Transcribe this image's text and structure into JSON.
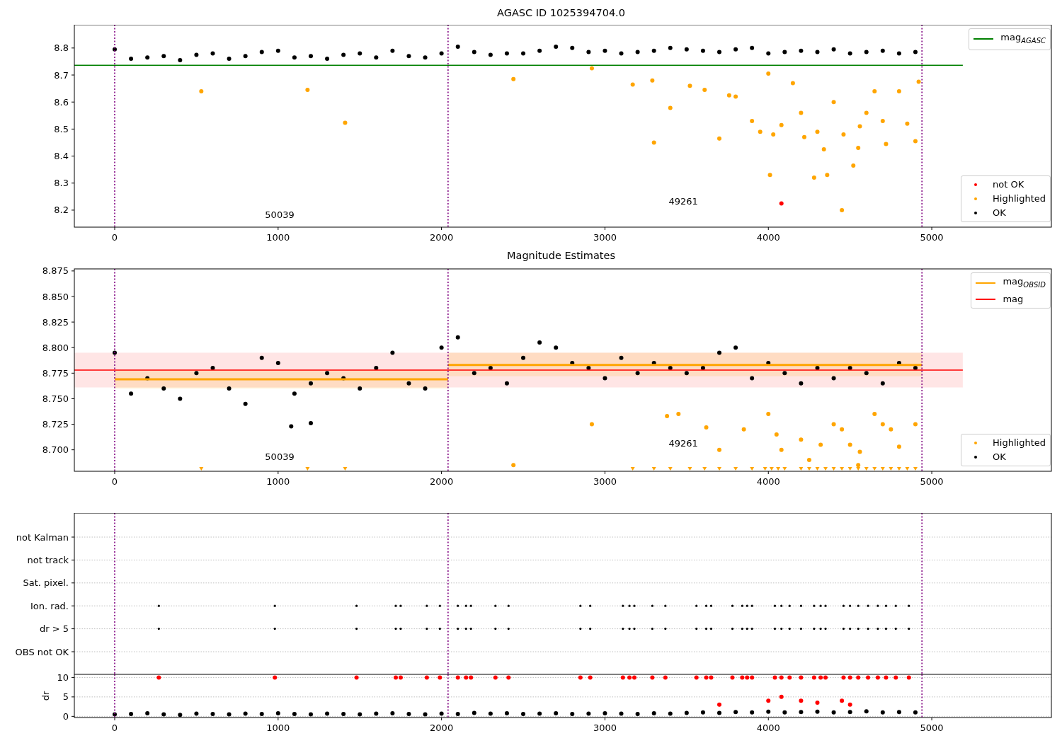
{
  "figure": {
    "axes": [
      {
        "title": "AGASC ID 1025394704.0",
        "chart_data": {
          "type": "scatter",
          "legend": "right",
          "xlim": [
            -247,
            5732
          ],
          "ylim": [
            8.137,
            8.886
          ],
          "xticks": [
            0,
            1000,
            2000,
            3000,
            4000,
            5000
          ],
          "yticks": [
            {
              "value": 8.2,
              "label": "8.2"
            },
            {
              "value": 8.3,
              "label": "8.3"
            },
            {
              "value": 8.4,
              "label": "8.4"
            },
            {
              "value": 8.5,
              "label": "8.5"
            },
            {
              "value": 8.6,
              "label": "8.6"
            },
            {
              "value": 8.7,
              "label": "8.7"
            },
            {
              "value": 8.8,
              "label": "8.8"
            }
          ],
          "series": [
            {
              "name": "mag$_{AGASC}$",
              "type": "line",
              "color": "#008000",
              "x": [
                -247,
                5190
              ],
              "values": [
                8.736,
                8.736
              ]
            },
            {
              "name": "OK",
              "color": "#000000",
              "marker": "circle",
              "x": [
                0,
                100,
                200,
                300,
                400,
                500,
                600,
                700,
                800,
                900,
                1000,
                1100,
                1200,
                1300,
                1400,
                1500,
                1600,
                1700,
                1800,
                1900,
                2000,
                2100,
                2200,
                2300,
                2400,
                2500,
                2600,
                2700,
                2800,
                2900,
                3000,
                3100,
                3200,
                3300,
                3400,
                3500,
                3600,
                3700,
                3800,
                3900,
                4000,
                4100,
                4200,
                4300,
                4400,
                4500,
                4600,
                4700,
                4800,
                4900
              ],
              "values": [
                8.795,
                8.76,
                8.765,
                8.77,
                8.755,
                8.775,
                8.78,
                8.76,
                8.77,
                8.785,
                8.79,
                8.765,
                8.77,
                8.76,
                8.775,
                8.78,
                8.765,
                8.79,
                8.77,
                8.765,
                8.78,
                8.805,
                8.785,
                8.775,
                8.78,
                8.78,
                8.79,
                8.805,
                8.8,
                8.785,
                8.79,
                8.78,
                8.785,
                8.79,
                8.8,
                8.795,
                8.79,
                8.785,
                8.795,
                8.8,
                8.78,
                8.785,
                8.79,
                8.785,
                8.795,
                8.78,
                8.785,
                8.79,
                8.78,
                8.785
              ]
            },
            {
              "name": "Highlighted",
              "color": "#ffa500",
              "marker": "circle",
              "x": [
                530,
                1180,
                1410,
                2440,
                2920,
                3170,
                3290,
                3300,
                3400,
                3520,
                3610,
                3700,
                3760,
                3800,
                3900,
                3950,
                4000,
                4010,
                4030,
                4080,
                4150,
                4200,
                4220,
                4280,
                4300,
                4340,
                4360,
                4400,
                4450,
                4460,
                4520,
                4550,
                4560,
                4600,
                4650,
                4700,
                4720,
                4800,
                4850,
                4900,
                4920
              ],
              "values": [
                8.64,
                8.645,
                8.523,
                8.685,
                8.725,
                8.665,
                8.68,
                8.45,
                8.578,
                8.66,
                8.645,
                8.465,
                8.625,
                8.62,
                8.53,
                8.49,
                8.705,
                8.33,
                8.48,
                8.515,
                8.67,
                8.56,
                8.47,
                8.32,
                8.49,
                8.425,
                8.33,
                8.6,
                8.2,
                8.48,
                8.365,
                8.43,
                8.51,
                8.56,
                8.64,
                8.53,
                8.445,
                8.64,
                8.52,
                8.455,
                8.675
              ]
            },
            {
              "name": "not OK",
              "color": "#ff0000",
              "marker": "circle",
              "x": [
                4080
              ],
              "values": [
                8.225
              ]
            }
          ],
          "ref_lines": [
            {
              "axis": "x",
              "value": 0,
              "color": "#800080"
            },
            {
              "axis": "x",
              "value": 2040,
              "color": "#800080"
            },
            {
              "axis": "x",
              "value": 4940,
              "color": "#800080"
            }
          ],
          "annotations": [
            "50039",
            "49261"
          ]
        }
      },
      {
        "title": "Magnitude Estimates",
        "chart_data": {
          "type": "scatter",
          "legend": "right",
          "xlim": [
            -247,
            5732
          ],
          "ylim": [
            8.679,
            8.877
          ],
          "xticks": [
            0,
            1000,
            2000,
            3000,
            4000,
            5000
          ],
          "yticks": [
            {
              "value": 8.7,
              "label": "8.700"
            },
            {
              "value": 8.725,
              "label": "8.725"
            },
            {
              "value": 8.75,
              "label": "8.750"
            },
            {
              "value": 8.775,
              "label": "8.775"
            },
            {
              "value": 8.8,
              "label": "8.800"
            },
            {
              "value": 8.825,
              "label": "8.825"
            },
            {
              "value": 8.85,
              "label": "8.850"
            },
            {
              "value": 8.875,
              "label": "8.875"
            }
          ],
          "series": [
            {
              "name": "OK",
              "color": "#000000",
              "marker": "circle",
              "x": [
                0,
                100,
                200,
                300,
                400,
                500,
                600,
                700,
                800,
                900,
                1000,
                1100,
                1200,
                1300,
                1400,
                1500,
                1600,
                1700,
                1800,
                1900,
                2000,
                2100,
                2200,
                2300,
                2400,
                2500,
                2600,
                2700,
                2800,
                2900,
                3000,
                3100,
                3200,
                3300,
                3400,
                3500,
                3600,
                3700,
                3800,
                3900,
                4000,
                4100,
                4200,
                4300,
                4400,
                4500,
                4600,
                4700,
                4800,
                4900,
                1080,
                1200
              ],
              "values": [
                8.795,
                8.755,
                8.77,
                8.76,
                8.75,
                8.775,
                8.78,
                8.76,
                8.745,
                8.79,
                8.785,
                8.755,
                8.765,
                8.775,
                8.77,
                8.76,
                8.78,
                8.795,
                8.765,
                8.76,
                8.8,
                8.81,
                8.775,
                8.78,
                8.765,
                8.79,
                8.805,
                8.8,
                8.785,
                8.78,
                8.77,
                8.79,
                8.775,
                8.785,
                8.78,
                8.775,
                8.78,
                8.795,
                8.8,
                8.77,
                8.785,
                8.775,
                8.765,
                8.78,
                8.77,
                8.78,
                8.775,
                8.765,
                8.785,
                8.78,
                8.723,
                8.726
              ]
            },
            {
              "name": "Highlighted",
              "color": "#ffa500",
              "marker": "circle",
              "x": [
                2440,
                2920,
                3380,
                3450,
                3620,
                3700,
                3850,
                4000,
                4050,
                4080,
                4200,
                4250,
                4320,
                4400,
                4450,
                4500,
                4550,
                4560,
                4650,
                4700,
                4750,
                4800,
                4900
              ],
              "values": [
                8.685,
                8.725,
                8.733,
                8.735,
                8.722,
                8.7,
                8.72,
                8.735,
                8.715,
                8.7,
                8.71,
                8.69,
                8.705,
                8.725,
                8.72,
                8.705,
                8.685,
                8.698,
                8.735,
                8.725,
                8.72,
                8.703,
                8.725
              ]
            },
            {
              "color": "#ffa500",
              "marker": "triangle",
              "x": [
                530,
                1180,
                1410,
                3170,
                3300,
                3400,
                3520,
                3610,
                3700,
                3800,
                3900,
                3980,
                4020,
                4060,
                4100,
                4200,
                4250,
                4300,
                4350,
                4400,
                4450,
                4500,
                4550,
                4600,
                4650,
                4700,
                4750,
                4800,
                4850,
                4900
              ],
              "values": [
                8.681,
                8.681,
                8.681,
                8.681,
                8.681,
                8.681,
                8.681,
                8.681,
                8.681,
                8.681,
                8.681,
                8.681,
                8.681,
                8.681,
                8.681,
                8.681,
                8.681,
                8.681,
                8.681,
                8.681,
                8.681,
                8.681,
                8.681,
                8.681,
                8.681,
                8.681,
                8.681,
                8.681,
                8.681,
                8.681
              ]
            },
            {
              "name": "mag$_{OBSID}$",
              "type": "line",
              "color": "#ffa500",
              "x": [
                0,
                2040,
                2040,
                4940
              ],
              "values": [
                8.769,
                8.769,
                8.783,
                8.783
              ]
            },
            {
              "name": "mag",
              "type": "line",
              "color": "#ff0000",
              "x": [
                -247,
                5190
              ],
              "values": [
                8.778,
                8.778
              ]
            }
          ],
          "bands": [
            {
              "axis": "y",
              "from": 8.761,
              "to": 8.795,
              "color": "#ff0000"
            },
            {
              "axis": "y",
              "from": 8.76,
              "to": 8.778,
              "color": "#ffa500"
            },
            {
              "axis": "y",
              "from": 8.772,
              "to": 8.795,
              "color": "#ffa500"
            }
          ],
          "ref_lines": [
            {
              "axis": "x",
              "value": 0,
              "color": "#800080"
            },
            {
              "axis": "x",
              "value": 2040,
              "color": "#800080"
            },
            {
              "axis": "x",
              "value": 4940,
              "color": "#800080"
            }
          ],
          "annotations": [
            "50039",
            "49261"
          ]
        }
      },
      {
        "flag_rows": [
          {
            "label": "not Kalman"
          },
          {
            "label": "not track"
          },
          {
            "label": "Sat. pixel."
          },
          {
            "label": "Ion. rad."
          },
          {
            "label": "dr > 5"
          },
          {
            "label": "OBS not OK"
          }
        ]
      },
      {
        "chart_data": {
          "type": "scatter",
          "ylabel": "dr",
          "xlim": [
            -247,
            5732
          ],
          "ylim": [
            -0.3,
            10.8
          ],
          "xticks": [
            0,
            1000,
            2000,
            3000,
            4000,
            5000
          ],
          "yticks": [
            0,
            5,
            10
          ],
          "series": [
            {
              "color": "#000000",
              "marker": "circle",
              "x": [
                0,
                100,
                200,
                300,
                400,
                500,
                600,
                700,
                800,
                900,
                1000,
                1100,
                1200,
                1300,
                1400,
                1500,
                1600,
                1700,
                1800,
                1900,
                2000,
                2100,
                2200,
                2300,
                2400,
                2500,
                2600,
                2700,
                2800,
                2900,
                3000,
                3100,
                3200,
                3300,
                3400,
                3500,
                3600,
                3700,
                3800,
                3900,
                4000,
                4100,
                4200,
                4300,
                4400,
                4500,
                4600,
                4700,
                4800,
                4900
              ],
              "values": [
                0.5,
                0.6,
                0.8,
                0.5,
                0.4,
                0.7,
                0.6,
                0.5,
                0.7,
                0.6,
                0.8,
                0.6,
                0.5,
                0.7,
                0.6,
                0.5,
                0.7,
                0.8,
                0.6,
                0.5,
                0.7,
                0.6,
                0.9,
                0.7,
                0.8,
                0.6,
                0.7,
                0.8,
                0.6,
                0.7,
                0.8,
                0.7,
                0.6,
                0.8,
                0.7,
                0.9,
                1.0,
                0.9,
                1.1,
                1.0,
                1.2,
                1.0,
                1.1,
                1.2,
                1.0,
                1.1,
                1.3,
                1.0,
                1.1,
                1.0
              ]
            },
            {
              "color": "#ff0000",
              "marker": "circle",
              "x": [
                270,
                980,
                1480,
                1720,
                1750,
                1910,
                1990,
                2100,
                2150,
                2180,
                2330,
                2410,
                2850,
                2910,
                3110,
                3150,
                3180,
                3290,
                3370,
                3560,
                3620,
                3650,
                3780,
                3840,
                3870,
                3900,
                4040,
                4080,
                4130,
                4200,
                4280,
                4320,
                4350,
                4460,
                4500,
                4550,
                4610,
                4670,
                4720,
                4780,
                4860,
                3700,
                4000,
                4080,
                4200,
                4300,
                4450,
                4500
              ],
              "values": [
                10,
                10,
                10,
                10,
                10,
                10,
                10,
                10,
                10,
                10,
                10,
                10,
                10,
                10,
                10,
                10,
                10,
                10,
                10,
                10,
                10,
                10,
                10,
                10,
                10,
                10,
                10,
                10,
                10,
                10,
                10,
                10,
                10,
                10,
                10,
                10,
                10,
                10,
                10,
                10,
                10,
                3,
                4,
                5,
                4,
                3.5,
                4,
                3
              ]
            }
          ],
          "ref_lines": [
            {
              "axis": "x",
              "value": 0,
              "color": "#800080"
            },
            {
              "axis": "x",
              "value": 2040,
              "color": "#800080"
            },
            {
              "axis": "x",
              "value": 4940,
              "color": "#800080"
            }
          ]
        }
      }
    ]
  }
}
